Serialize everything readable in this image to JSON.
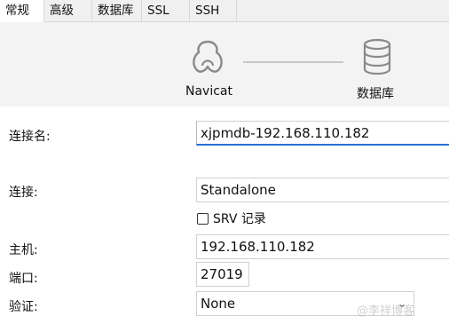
{
  "tabs": [
    {
      "label": "常规",
      "active": true
    },
    {
      "label": "高级",
      "active": false
    },
    {
      "label": "数据库",
      "active": false
    },
    {
      "label": "SSL",
      "active": false
    },
    {
      "label": "SSH",
      "active": false
    }
  ],
  "steps": {
    "navicat_label": "Navicat",
    "database_label": "数据库"
  },
  "form": {
    "connection_name": {
      "label": "连接名:",
      "value": "xjpmdb-192.168.110.182"
    },
    "connection": {
      "label": "连接:",
      "value": "Standalone"
    },
    "srv_record": {
      "label": "SRV 记录",
      "checked": false
    },
    "host": {
      "label": "主机:",
      "value": "192.168.110.182"
    },
    "port": {
      "label": "端口:",
      "value": "27019"
    },
    "auth": {
      "label": "验证:",
      "value": "None"
    }
  },
  "watermark": "@李祥博客",
  "colors": {
    "focus_accent": "#2a6fd6",
    "tabbar_bg": "#f0f0f0",
    "header_bg": "#f3f3f3"
  }
}
